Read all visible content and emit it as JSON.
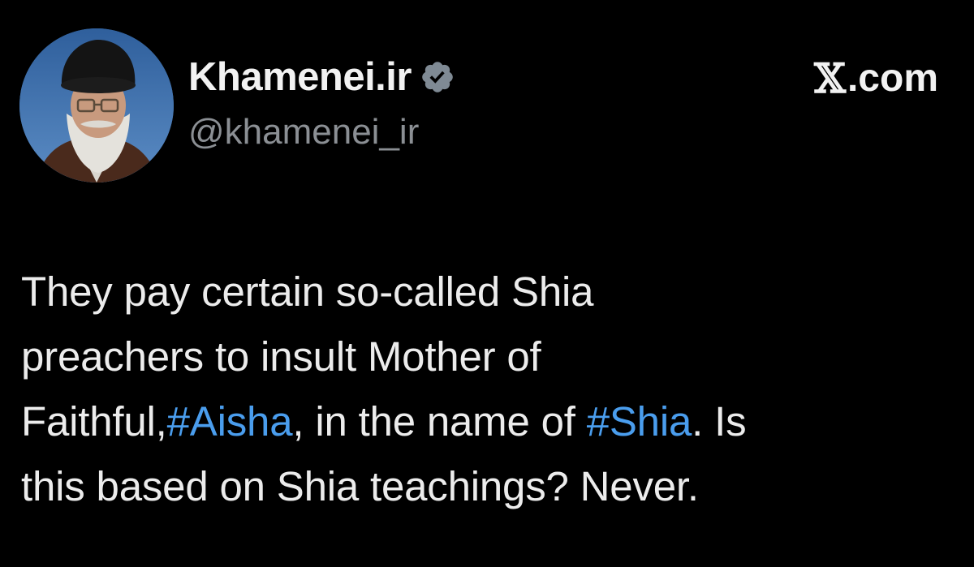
{
  "colors": {
    "background": "#000000",
    "text": "#ececec",
    "handle": "#8b8f94",
    "hashtag": "#4a9ded",
    "verified_badge": "#7f8a94"
  },
  "author": {
    "display_name": "Khamenei.ir",
    "handle": "@khamenei_ir",
    "verified_icon": "verified-badge-icon"
  },
  "source": {
    "logo_glyph": "𝕏",
    "label": ".com"
  },
  "tweet": {
    "line1": "They pay certain so-called Shia",
    "line2": "preachers to insult Mother of",
    "line3_a": "Faithful,",
    "hashtag1": "#Aisha",
    "line3_b": ", in the name of ",
    "hashtag2": "#Shia",
    "line3_c": ". Is",
    "line4": "this based on Shia teachings? Never."
  }
}
